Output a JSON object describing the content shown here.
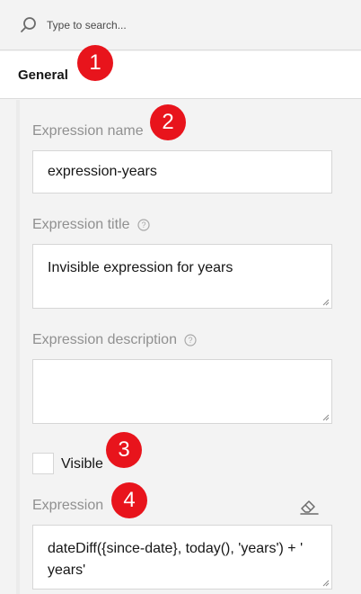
{
  "search": {
    "placeholder": "Type to search..."
  },
  "tabs": [
    {
      "label": "General"
    }
  ],
  "fields": {
    "expression_name": {
      "label": "Expression name",
      "value": "expression-years"
    },
    "expression_title": {
      "label": "Expression title",
      "value": "Invisible expression for years"
    },
    "expression_description": {
      "label": "Expression description",
      "value": ""
    },
    "visible": {
      "label": "Visible",
      "checked": false
    },
    "expression": {
      "label": "Expression",
      "value": "dateDiff({since-date}, today(), 'years') + ' years'"
    }
  },
  "badges": [
    "1",
    "2",
    "3",
    "4"
  ],
  "colors": {
    "badge": "#e8141c",
    "panel": "#f3f3f3",
    "label": "#909090"
  },
  "icons": [
    "search-icon",
    "help-icon",
    "eraser-icon"
  ]
}
